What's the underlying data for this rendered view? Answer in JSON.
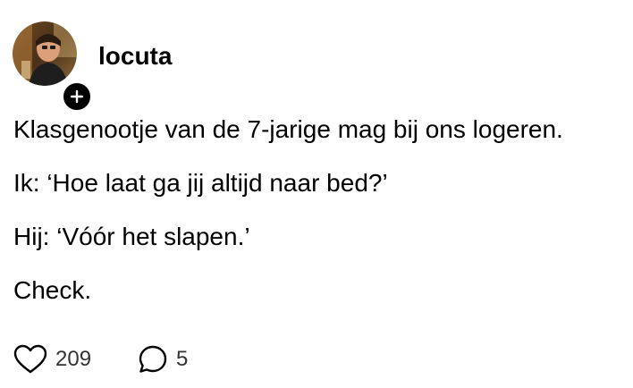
{
  "post": {
    "author": {
      "username": "locuta",
      "avatar_icon": "user-avatar-photo",
      "follow_icon": "plus-icon"
    },
    "lines": [
      "Klasgenootje van de 7-jarige mag bij ons logeren.",
      "Ik: ‘Hoe laat ga jij altijd naar bed?’",
      "Hij: ‘Vóór het slapen.’",
      "Check."
    ],
    "actions": {
      "likes": "209",
      "comments": "5",
      "like_icon": "heart-icon",
      "comment_icon": "comment-bubble-icon"
    }
  },
  "colors": {
    "text": "#000000",
    "count_text": "#333333",
    "badge": "#000000",
    "background": "#ffffff"
  }
}
